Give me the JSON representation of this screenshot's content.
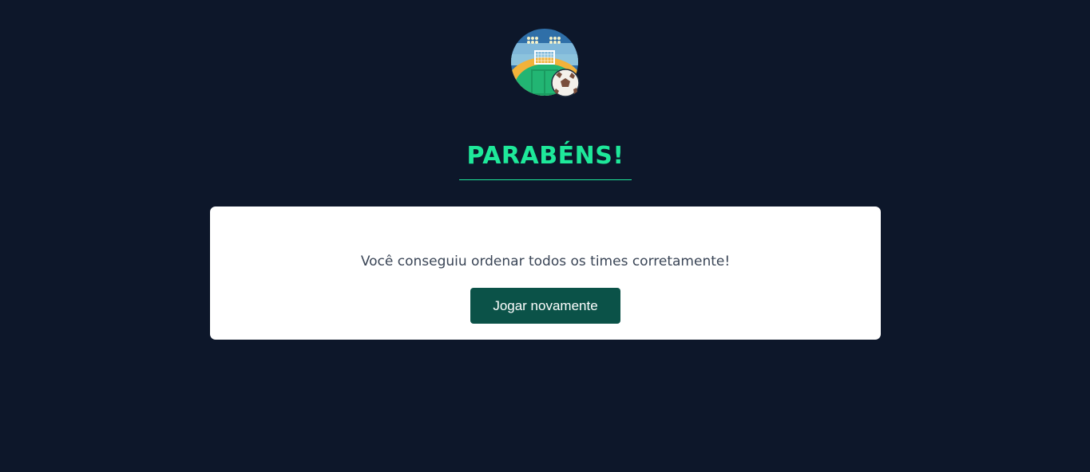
{
  "header": {
    "logo_icon": "stadium-soccer-ball-icon",
    "title": "PARABÉNS!"
  },
  "card": {
    "message": "Você conseguiu ordenar todos os times corretamente!",
    "button_label": "Jogar novamente"
  },
  "colors": {
    "background": "#0d172a",
    "accent": "#1ee89a",
    "card": "#ffffff",
    "button": "#0b5248",
    "message_text": "#3a4556"
  }
}
